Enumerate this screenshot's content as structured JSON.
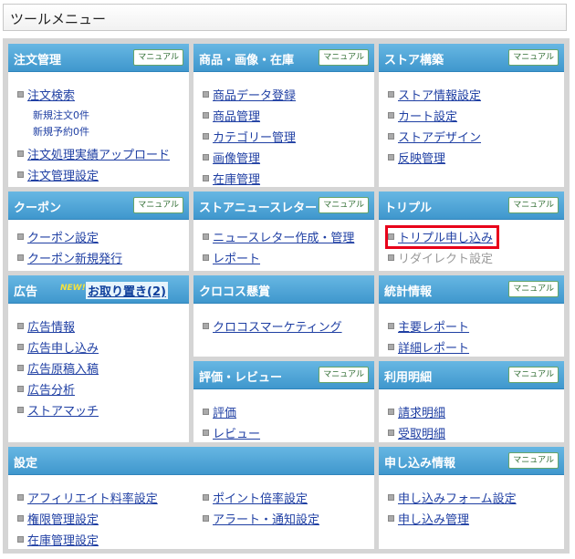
{
  "page_title": "ツールメニュー",
  "manual_label": "マニュアル",
  "panels": {
    "order": {
      "title": "注文管理",
      "items": [
        "注文検索",
        "注文処理実績アップロード",
        "注文管理設定"
      ],
      "sub": [
        "新規注文0件",
        "新規予約0件"
      ]
    },
    "product": {
      "title": "商品・画像・在庫",
      "items": [
        "商品データ登録",
        "商品管理",
        "カテゴリー管理",
        "画像管理",
        "在庫管理"
      ]
    },
    "store": {
      "title": "ストア構築",
      "items": [
        "ストア情報設定",
        "カート設定",
        "ストアデザイン",
        "反映管理"
      ]
    },
    "coupon": {
      "title": "クーポン",
      "items": [
        "クーポン設定",
        "クーポン新規発行"
      ]
    },
    "newsletter": {
      "title": "ストアニュースレター",
      "items": [
        "ニュースレター作成・管理",
        "レポート"
      ]
    },
    "trouble": {
      "title": "トリプル",
      "items": [
        "トリプル申し込み",
        "リダイレクト設定"
      ]
    },
    "ads": {
      "title": "広告",
      "new_badge": "NEW!",
      "link": "お取り置き(2)",
      "items": [
        "広告情報",
        "広告申し込み",
        "広告原稿入稿",
        "広告分析",
        "ストアマッチ"
      ]
    },
    "crocos": {
      "title": "クロコス懸賞",
      "items": [
        "クロコスマーケティング"
      ]
    },
    "stats": {
      "title": "統計情報",
      "items": [
        "主要レポート",
        "詳細レポート"
      ]
    },
    "review": {
      "title": "評価・レビュー",
      "items": [
        "評価",
        "レビュー"
      ]
    },
    "usage": {
      "title": "利用明細",
      "items": [
        "請求明細",
        "受取明細"
      ]
    },
    "settings": {
      "title": "設定",
      "items_left": [
        "アフィリエイト料率設定",
        "権限管理設定",
        "在庫管理設定"
      ],
      "items_right": [
        "ポイント倍率設定",
        "アラート・通知設定"
      ]
    },
    "application": {
      "title": "申し込み情報",
      "items": [
        "申し込みフォーム設定",
        "申し込み管理"
      ]
    }
  },
  "colors": {
    "header": "#4aa3d6",
    "highlight": "#e8001a",
    "link": "#1f3fa3"
  }
}
